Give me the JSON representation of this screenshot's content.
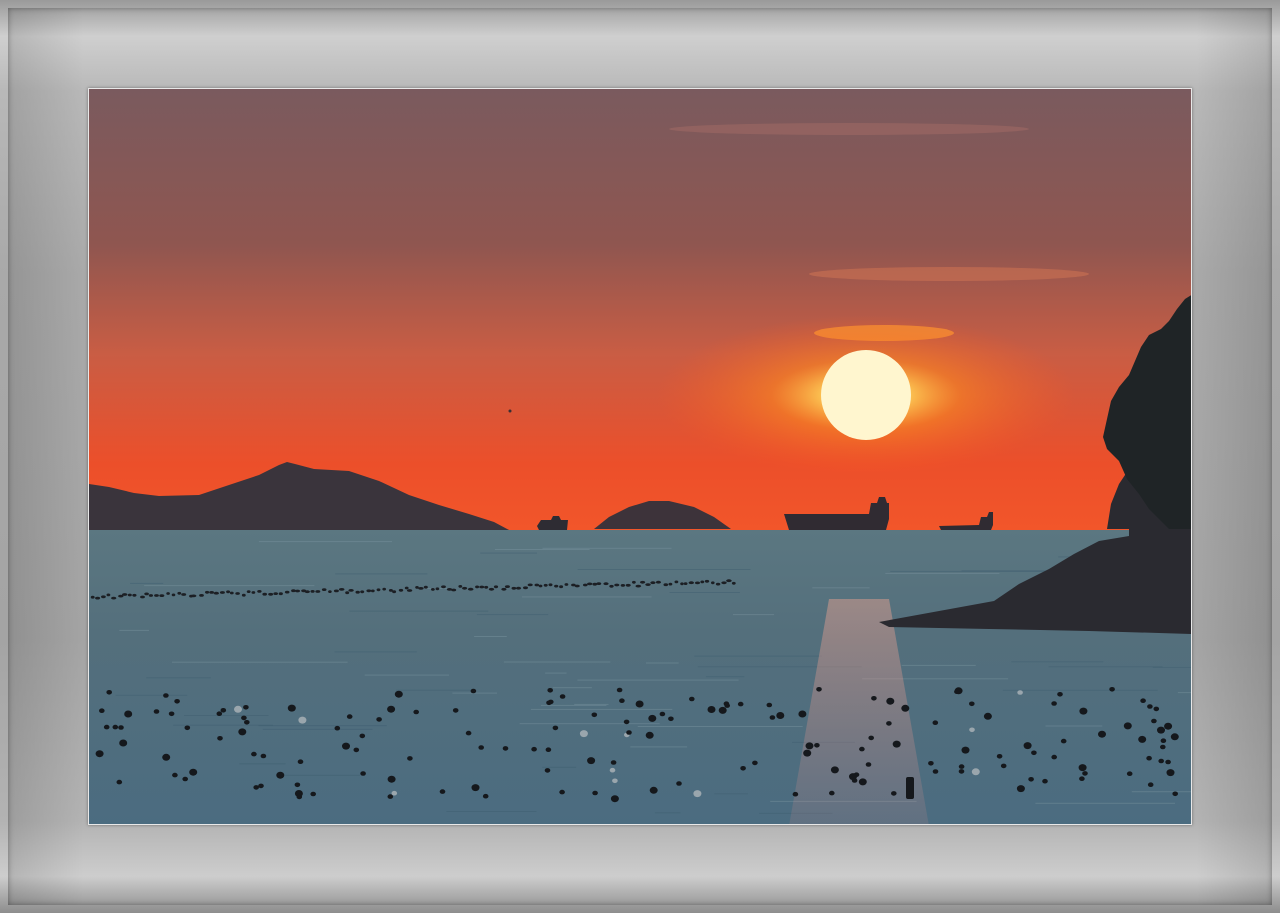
{
  "photo": {
    "subject": "sunset-over-sea",
    "colors": {
      "sky_top": "#7b5a5c",
      "sky_mid": "#c65a48",
      "sky_horizon": "#f2552a",
      "sun_core": "#fff7d0",
      "sun_glow": "#ff9a1f",
      "sea_far": "#5c7882",
      "sea_near": "#4d6f82",
      "silhouette": "#2a2c33",
      "frame": "#a8a8a8"
    }
  }
}
